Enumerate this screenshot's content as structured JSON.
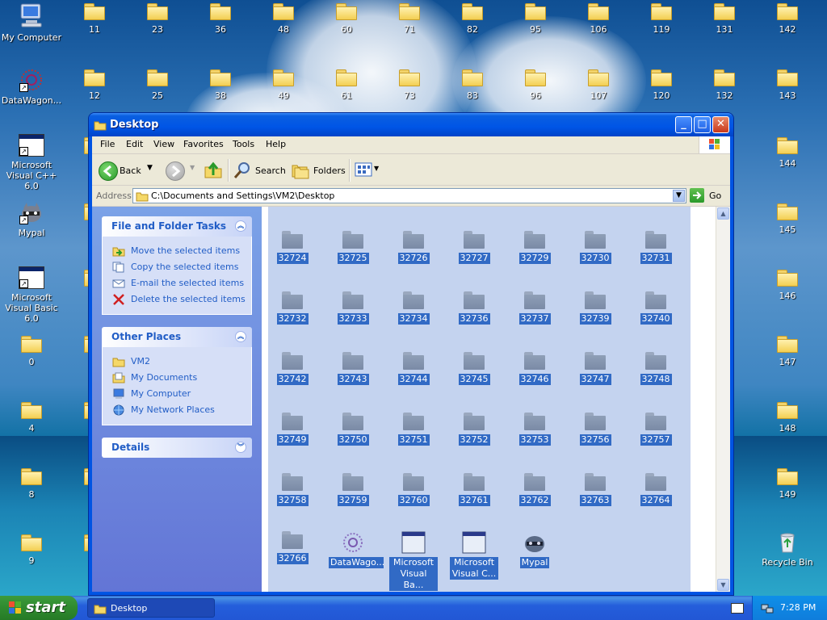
{
  "desktop": {
    "top_row": [
      "11",
      "23",
      "36",
      "48",
      "60",
      "71",
      "82",
      "95",
      "106",
      "119",
      "131",
      "142"
    ],
    "second_row": [
      "12",
      "25",
      "38",
      "49",
      "61",
      "73",
      "83",
      "96",
      "107",
      "120",
      "132",
      "143"
    ],
    "left_icons": [
      "My Computer",
      "DataWagon...",
      "Microsoft Visual C++ 6.0",
      "Mypal",
      "Microsoft Visual Basic 6.0",
      "0",
      "4",
      "8",
      "9"
    ],
    "right_icons": [
      "144",
      "145",
      "146",
      "147",
      "148",
      "149",
      "Recycle Bin"
    ]
  },
  "window": {
    "title": "Desktop",
    "menu": [
      "File",
      "Edit",
      "View",
      "Favorites",
      "Tools",
      "Help"
    ],
    "toolbar": {
      "back": "Back",
      "search": "Search",
      "folders": "Folders"
    },
    "address": {
      "label": "Address",
      "value": "C:\\Documents and Settings\\VM2\\Desktop",
      "go": "Go"
    },
    "tasks": {
      "title": "File and Folder Tasks",
      "items": [
        "Move the selected items",
        "Copy the selected items",
        "E-mail the selected items",
        "Delete the selected items"
      ]
    },
    "other_places": {
      "title": "Other Places",
      "items": [
        "VM2",
        "My Documents",
        "My Computer",
        "My Network Places"
      ]
    },
    "details": {
      "title": "Details"
    },
    "items": [
      "32724",
      "32725",
      "32726",
      "32727",
      "32729",
      "32730",
      "32731",
      "32732",
      "32733",
      "32734",
      "32736",
      "32737",
      "32739",
      "32740",
      "32742",
      "32743",
      "32744",
      "32745",
      "32746",
      "32747",
      "32748",
      "32749",
      "32750",
      "32751",
      "32752",
      "32753",
      "32756",
      "32757",
      "32758",
      "32759",
      "32760",
      "32761",
      "32762",
      "32763",
      "32764",
      "32766",
      "DataWago...",
      "Microsoft Visual Ba...",
      "Microsoft Visual C...",
      "Mypal"
    ]
  },
  "taskbar": {
    "start": "start",
    "task": "Desktop",
    "clock": "7:28 PM"
  }
}
